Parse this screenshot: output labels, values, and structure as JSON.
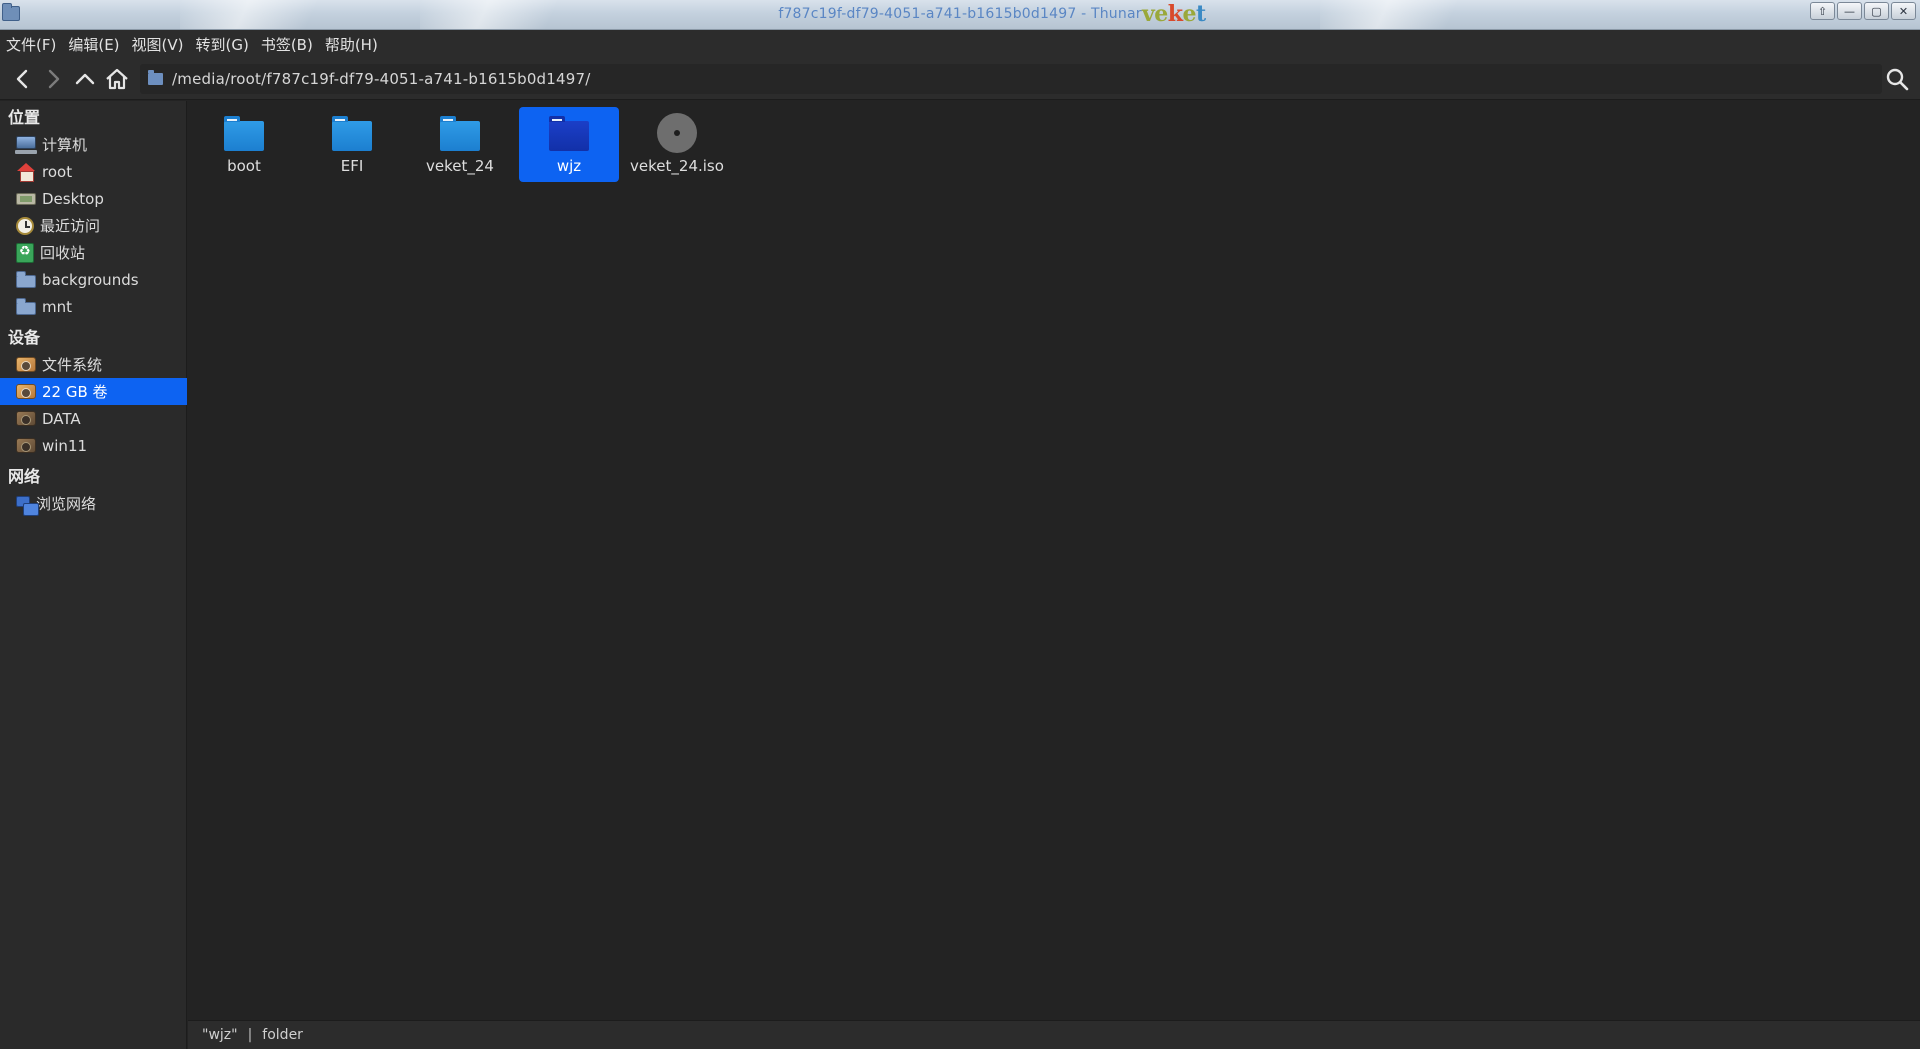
{
  "window": {
    "title": "f787c19f-df79-4051-a741-b1615b0d1497 - Thunar",
    "brand": "veket",
    "buttons": [
      "shade",
      "minimize",
      "maximize",
      "close"
    ],
    "button_glyphs": [
      "⇧",
      "—",
      "▢",
      "✕"
    ]
  },
  "menubar": {
    "items": [
      "文件(F)",
      "编辑(E)",
      "视图(V)",
      "转到(G)",
      "书签(B)",
      "帮助(H)"
    ]
  },
  "toolbar": {
    "back_icon": "chevron-left-icon",
    "forward_icon": "chevron-right-icon",
    "up_icon": "chevron-up-icon",
    "home_icon": "home-icon",
    "path": "/media/root/f787c19f-df79-4051-a741-b1615b0d1497/",
    "search_icon": "search-icon"
  },
  "sidebar": {
    "sections": [
      {
        "header": "位置",
        "items": [
          {
            "label": "计算机",
            "icon": "computer-icon"
          },
          {
            "label": "root",
            "icon": "home-folder-icon"
          },
          {
            "label": "Desktop",
            "icon": "desktop-icon"
          },
          {
            "label": "最近访问",
            "icon": "clock-icon"
          },
          {
            "label": "回收站",
            "icon": "trash-icon"
          },
          {
            "label": "backgrounds",
            "icon": "folder-icon"
          },
          {
            "label": "mnt",
            "icon": "folder-icon"
          }
        ]
      },
      {
        "header": "设备",
        "items": [
          {
            "label": "文件系统",
            "icon": "drive-icon"
          },
          {
            "label": "22 GB 卷",
            "icon": "drive-icon",
            "active": true
          },
          {
            "label": "DATA",
            "icon": "drive-icon"
          },
          {
            "label": "win11",
            "icon": "drive-icon"
          }
        ]
      },
      {
        "header": "网络",
        "items": [
          {
            "label": "浏览网络",
            "icon": "network-icon"
          }
        ]
      }
    ]
  },
  "files": [
    {
      "name": "boot",
      "type": "folder"
    },
    {
      "name": "EFI",
      "type": "folder"
    },
    {
      "name": "veket_24",
      "type": "folder"
    },
    {
      "name": "wjz",
      "type": "folder",
      "selected": true
    },
    {
      "name": "veket_24.iso",
      "type": "disc-image"
    }
  ],
  "statusbar": {
    "selection": "\"wjz\"",
    "separator": "|",
    "kind": "folder"
  },
  "colors": {
    "accent": "#0d63f2",
    "background": "#232323",
    "folder": "#1c7fd0"
  }
}
